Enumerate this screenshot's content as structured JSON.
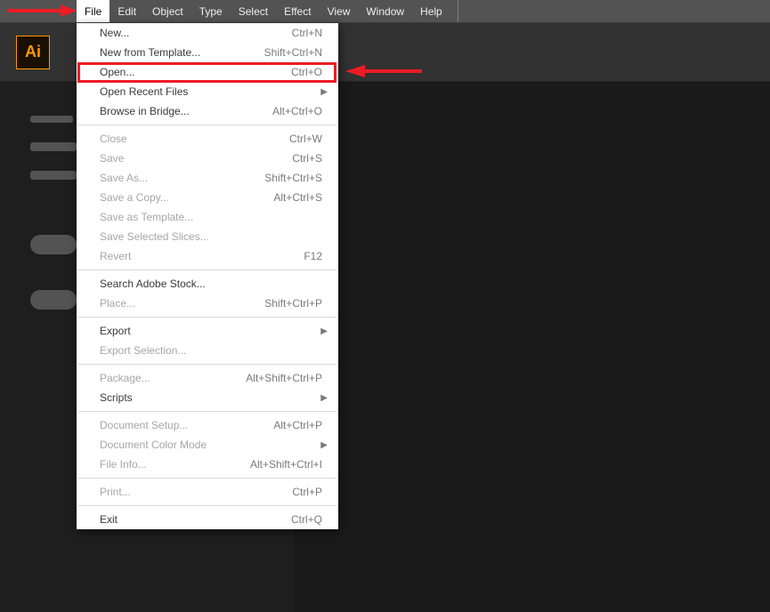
{
  "menubar": {
    "items": [
      {
        "label": "File",
        "active": true
      },
      {
        "label": "Edit"
      },
      {
        "label": "Object"
      },
      {
        "label": "Type"
      },
      {
        "label": "Select"
      },
      {
        "label": "Effect"
      },
      {
        "label": "View"
      },
      {
        "label": "Window"
      },
      {
        "label": "Help"
      }
    ]
  },
  "appbar": {
    "logo_text": "Ai"
  },
  "dropdown": {
    "groups": [
      [
        {
          "label": "New...",
          "shortcut": "Ctrl+N"
        },
        {
          "label": "New from Template...",
          "shortcut": "Shift+Ctrl+N"
        },
        {
          "label": "Open...",
          "shortcut": "Ctrl+O",
          "highlighted": true
        },
        {
          "label": "Open Recent Files",
          "submenu": true
        },
        {
          "label": "Browse in Bridge...",
          "shortcut": "Alt+Ctrl+O"
        }
      ],
      [
        {
          "label": "Close",
          "shortcut": "Ctrl+W",
          "disabled": true
        },
        {
          "label": "Save",
          "shortcut": "Ctrl+S",
          "disabled": true
        },
        {
          "label": "Save As...",
          "shortcut": "Shift+Ctrl+S",
          "disabled": true
        },
        {
          "label": "Save a Copy...",
          "shortcut": "Alt+Ctrl+S",
          "disabled": true
        },
        {
          "label": "Save as Template...",
          "disabled": true
        },
        {
          "label": "Save Selected Slices...",
          "disabled": true
        },
        {
          "label": "Revert",
          "shortcut": "F12",
          "disabled": true
        }
      ],
      [
        {
          "label": "Search Adobe Stock..."
        },
        {
          "label": "Place...",
          "shortcut": "Shift+Ctrl+P",
          "disabled": true
        }
      ],
      [
        {
          "label": "Export",
          "submenu": true
        },
        {
          "label": "Export Selection...",
          "disabled": true
        }
      ],
      [
        {
          "label": "Package...",
          "shortcut": "Alt+Shift+Ctrl+P",
          "disabled": true
        },
        {
          "label": "Scripts",
          "submenu": true
        }
      ],
      [
        {
          "label": "Document Setup...",
          "shortcut": "Alt+Ctrl+P",
          "disabled": true
        },
        {
          "label": "Document Color Mode",
          "submenu": true,
          "disabled": true
        },
        {
          "label": "File Info...",
          "shortcut": "Alt+Shift+Ctrl+I",
          "disabled": true
        }
      ],
      [
        {
          "label": "Print...",
          "shortcut": "Ctrl+P",
          "disabled": true
        }
      ],
      [
        {
          "label": "Exit",
          "shortcut": "Ctrl+Q"
        }
      ]
    ]
  },
  "annotations": {
    "arrow1": "points to File menu",
    "arrow2": "points to Open... item",
    "highlight_color": "#ed1c24"
  }
}
